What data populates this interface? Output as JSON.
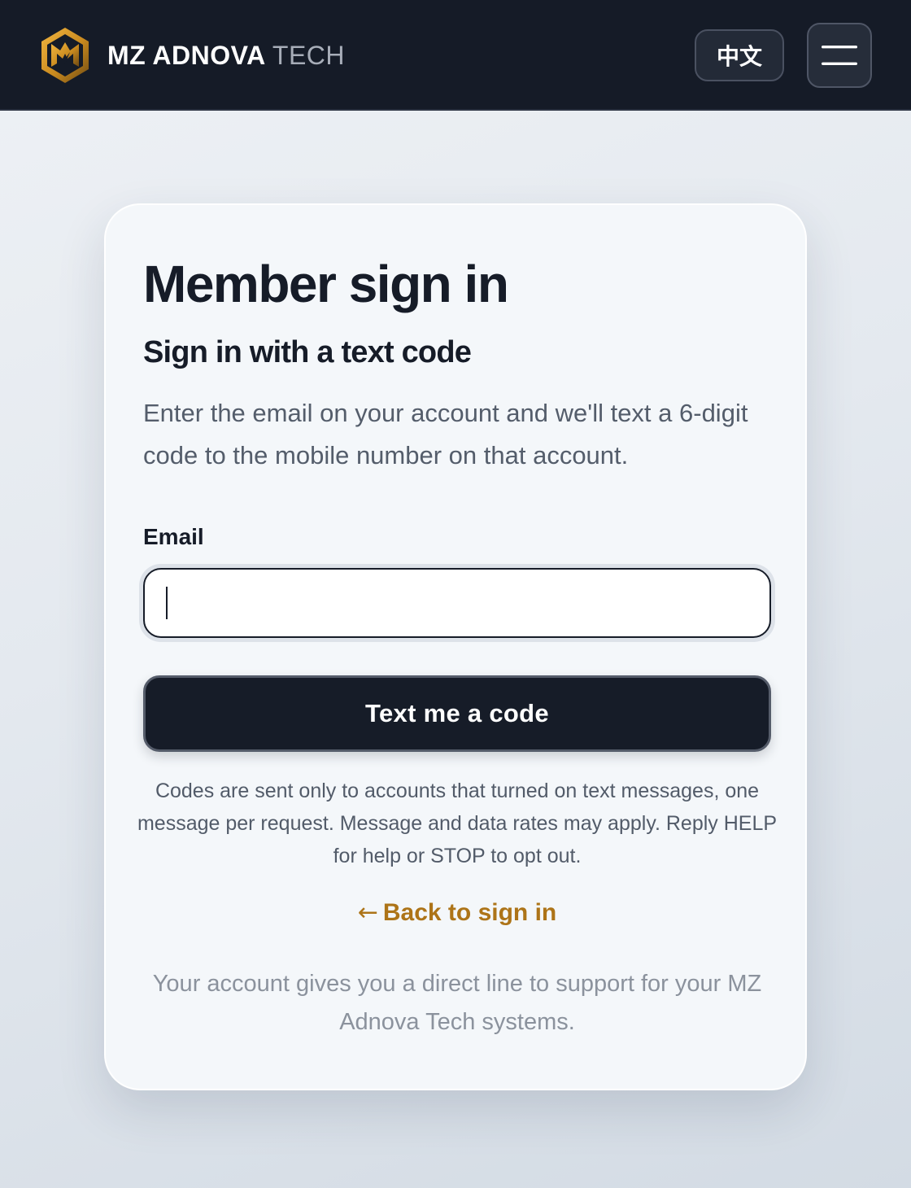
{
  "header": {
    "brand_bold": "MZ ADNOVA",
    "brand_light": "TECH",
    "logo_icon": "hexagon-m-logo",
    "language_toggle_label": "中文",
    "menu_icon": "hamburger-menu-icon",
    "background_color": "#151b27",
    "logo_accent_color": "#e0a12c"
  },
  "card": {
    "title": "Member sign in",
    "subtitle": "Sign in with a text code",
    "description": "Enter the email on your account and we'll text a 6-digit code to the mobile number on that account.",
    "email": {
      "label": "Email",
      "value": "",
      "placeholder": ""
    },
    "submit_label": "Text me a code",
    "notice": "Codes are sent only to accounts that turned on text messages, one message per request. Message and data rates may apply. Reply HELP for help or STOP to opt out.",
    "back_link": {
      "arrow": "←",
      "label": "Back to sign in"
    },
    "footer_note": "Your account gives you a direct line to support for your MZ Adnova Tech systems."
  },
  "colors": {
    "primary_dark": "#161c28",
    "link_accent": "#ad7418",
    "muted_text": "#8b929d"
  }
}
